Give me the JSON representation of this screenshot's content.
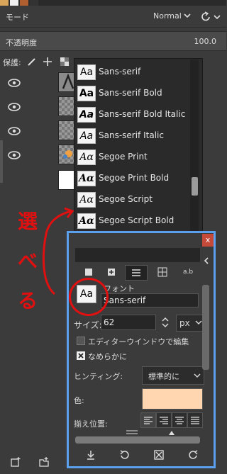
{
  "mode": {
    "label": "モード",
    "value": "Normal"
  },
  "opacity": {
    "label": "不透明度",
    "value": "100.0"
  },
  "lock": {
    "label": "保護:"
  },
  "font_popup": {
    "items": [
      {
        "sample": "Aa",
        "name": "Sans-serif"
      },
      {
        "sample": "Aa",
        "name": "Sans-serif Bold"
      },
      {
        "sample": "Aa",
        "name": "Sans-serif Bold Italic"
      },
      {
        "sample": "Aa",
        "name": "Sans-serif Italic"
      },
      {
        "sample": "Aα",
        "name": "Segoe Print"
      },
      {
        "sample": "Aα",
        "name": "Segoe Print Bold"
      },
      {
        "sample": "Aα",
        "name": "Segoe Script"
      },
      {
        "sample": "Aα",
        "name": "Segoe Script Bold"
      }
    ]
  },
  "tool_options": {
    "close": "x",
    "tab_text": "a.b",
    "font_label": "フォント",
    "font_preview": "Aa",
    "font_value": "Sans-serif",
    "size_label": "サイズ:",
    "size_value": "62",
    "unit_value": "px",
    "editor_checkbox": "エディターウインドウで編集",
    "antialias_checkbox": "なめらかに",
    "hinting_label": "ヒンティング:",
    "hinting_value": "標準的に",
    "color_label": "色:",
    "color_value": "#ffd6b0",
    "align_label": "揃え位置:"
  },
  "annotation": {
    "text": "選べる",
    "color": "#e01010"
  }
}
